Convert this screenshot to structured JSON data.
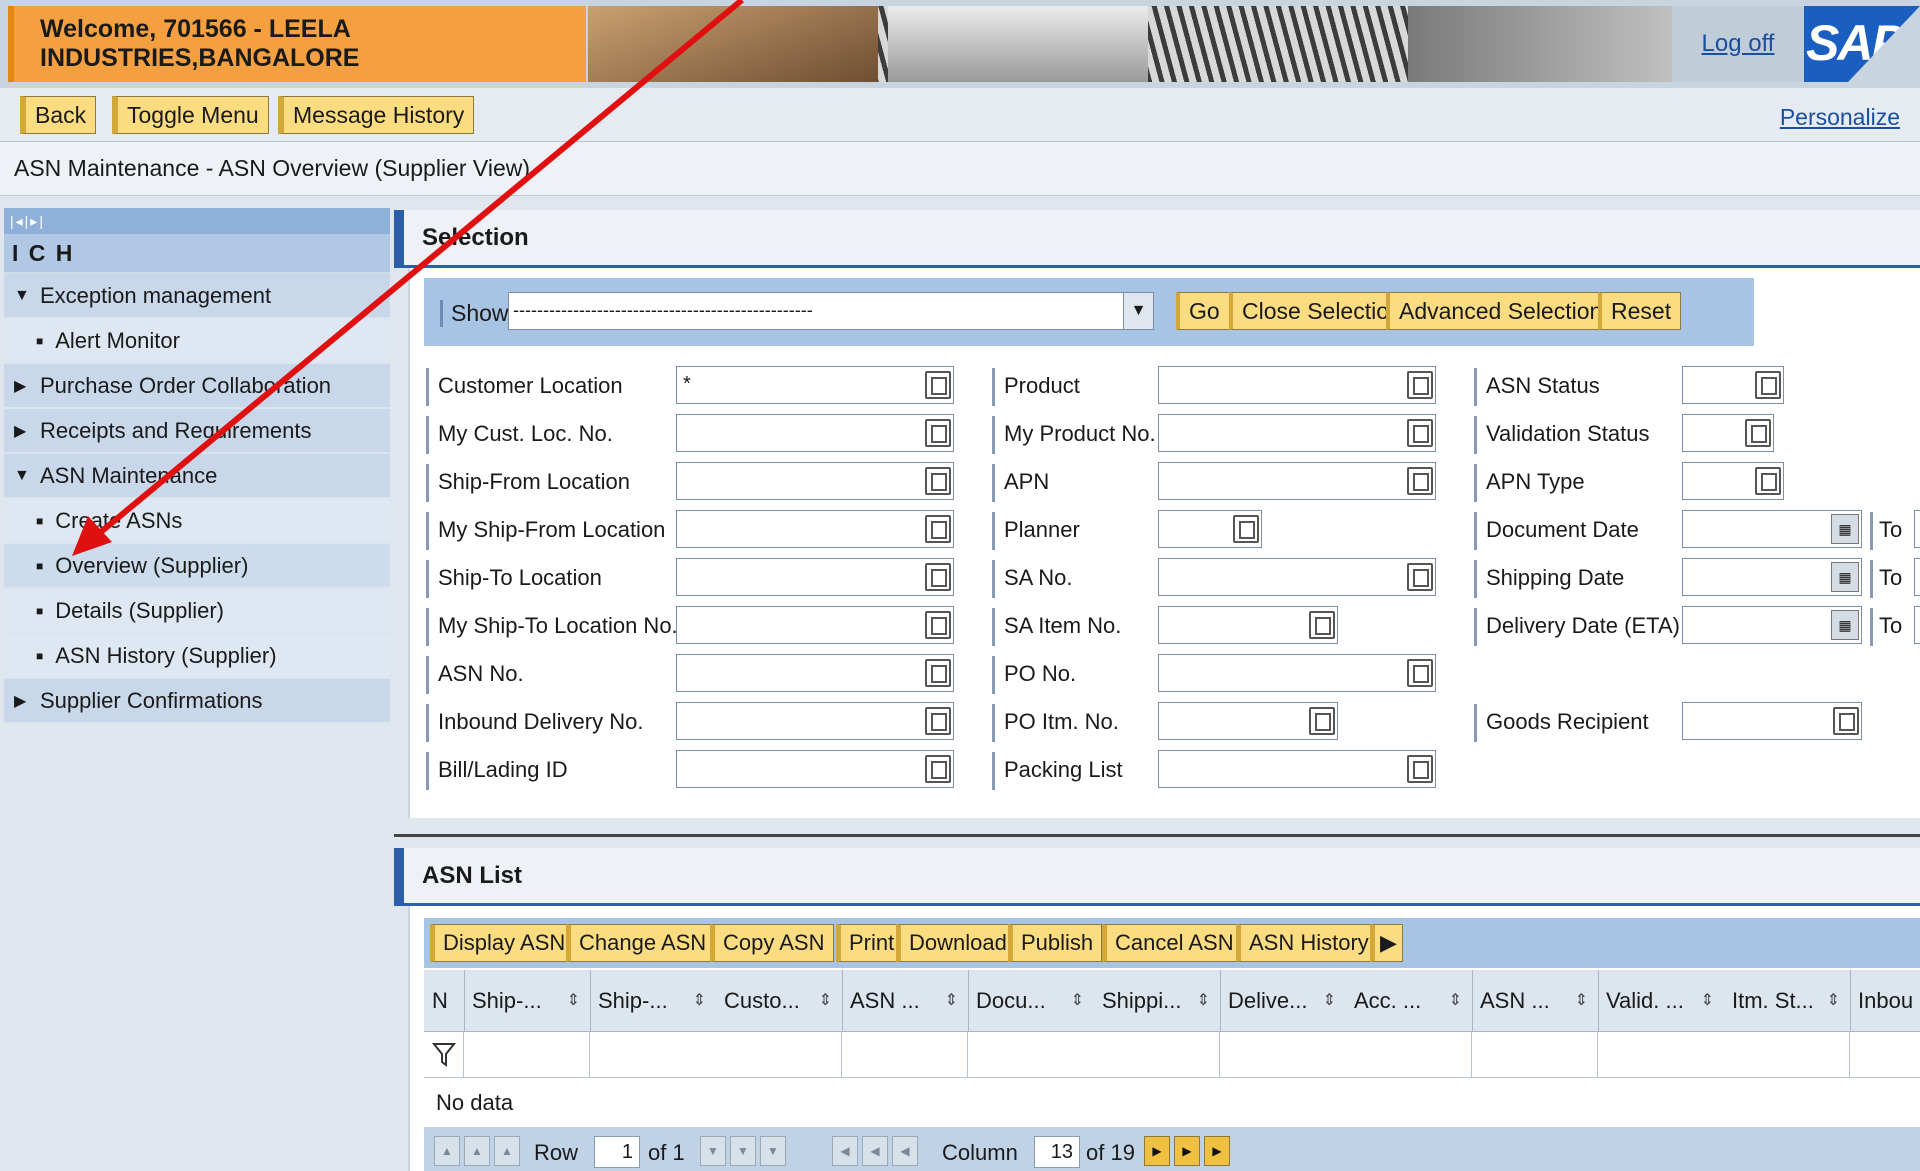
{
  "header": {
    "welcome": "Welcome, 701566 - LEELA INDUSTRIES,BANGALORE",
    "logoff": "Log off",
    "logo": "SAP"
  },
  "toolbar": {
    "back": "Back",
    "toggle_menu": "Toggle Menu",
    "message_history": "Message History",
    "personalize": "Personalize"
  },
  "breadcrumb": "ASN Maintenance - ASN Overview (Supplier View)",
  "nav": {
    "title": "I C H",
    "pager_glyphs": "|◂|▸|",
    "items": [
      {
        "label": "Exception management",
        "type": "group",
        "expanded": true
      },
      {
        "label": "Alert Monitor",
        "type": "sub"
      },
      {
        "label": "Purchase Order Collaboration",
        "type": "group",
        "expanded": false
      },
      {
        "label": "Receipts and Requirements",
        "type": "group",
        "expanded": false
      },
      {
        "label": "ASN Maintenance",
        "type": "group",
        "expanded": true
      },
      {
        "label": "Create ASNs",
        "type": "sub"
      },
      {
        "label": "Overview (Supplier)",
        "type": "sub",
        "selected": true
      },
      {
        "label": "Details (Supplier)",
        "type": "sub"
      },
      {
        "label": "ASN History (Supplier)",
        "type": "sub"
      },
      {
        "label": "Supplier Confirmations",
        "type": "group",
        "expanded": false
      }
    ]
  },
  "selection": {
    "title": "Selection",
    "show_label": "Show",
    "show_value": "--------------------------------------------------",
    "buttons": {
      "go": "Go",
      "close": "Close Selection",
      "advanced": "Advanced Selection",
      "reset": "Reset"
    },
    "fields_col1": [
      {
        "label": "Customer Location",
        "value": "*"
      },
      {
        "label": "My Cust. Loc. No.",
        "value": ""
      },
      {
        "label": "Ship-From Location",
        "value": ""
      },
      {
        "label": "My Ship-From Location",
        "value": ""
      },
      {
        "label": "Ship-To Location",
        "value": ""
      },
      {
        "label": "My Ship-To Location No.",
        "value": ""
      },
      {
        "label": "ASN No.",
        "value": ""
      },
      {
        "label": "Inbound Delivery No.",
        "value": ""
      },
      {
        "label": "Bill/Lading ID",
        "value": ""
      }
    ],
    "fields_col2": [
      {
        "label": "Product",
        "value": ""
      },
      {
        "label": "My Product No.",
        "value": ""
      },
      {
        "label": "APN",
        "value": ""
      },
      {
        "label": "Planner",
        "value": ""
      },
      {
        "label": "SA No.",
        "value": ""
      },
      {
        "label": "SA Item No.",
        "value": ""
      },
      {
        "label": "PO No.",
        "value": ""
      },
      {
        "label": "PO Itm. No.",
        "value": ""
      },
      {
        "label": "Packing List",
        "value": ""
      }
    ],
    "fields_col3": [
      {
        "label": "ASN Status",
        "value": ""
      },
      {
        "label": "Validation Status",
        "value": ""
      },
      {
        "label": "APN Type",
        "value": ""
      },
      {
        "label": "Document Date",
        "value": "",
        "to": "To"
      },
      {
        "label": "Shipping Date",
        "value": "",
        "to": "To"
      },
      {
        "label": "Delivery Date (ETA)",
        "value": "",
        "to": "To"
      },
      {
        "label": "Goods Recipient",
        "value": ""
      }
    ]
  },
  "asn_list": {
    "title": "ASN List",
    "buttons": [
      "Display ASN",
      "Change ASN",
      "Copy ASN",
      "Print",
      "Download",
      "Publish",
      "Cancel ASN",
      "ASN History"
    ],
    "more": "▶",
    "columns": [
      "N",
      "Ship-...",
      "Ship-...",
      "Custo...",
      "ASN ...",
      "Docu...",
      "Shippi...",
      "Delive...",
      "Acc. ...",
      "ASN ...",
      "Valid. ...",
      "Itm. St...",
      "Inbou"
    ],
    "sort_glyph": "⇕",
    "no_data": "No data",
    "pager": {
      "row_label": "Row",
      "row_value": "1",
      "row_of": "of 1",
      "column_label": "Column",
      "column_value": "13",
      "column_of": "of 19"
    }
  },
  "colors": {
    "accent_orange": "#f5a040",
    "button_yellow": "#fbdc80",
    "header_blue": "#2a5ea8",
    "annotation_red": "#e01010"
  }
}
